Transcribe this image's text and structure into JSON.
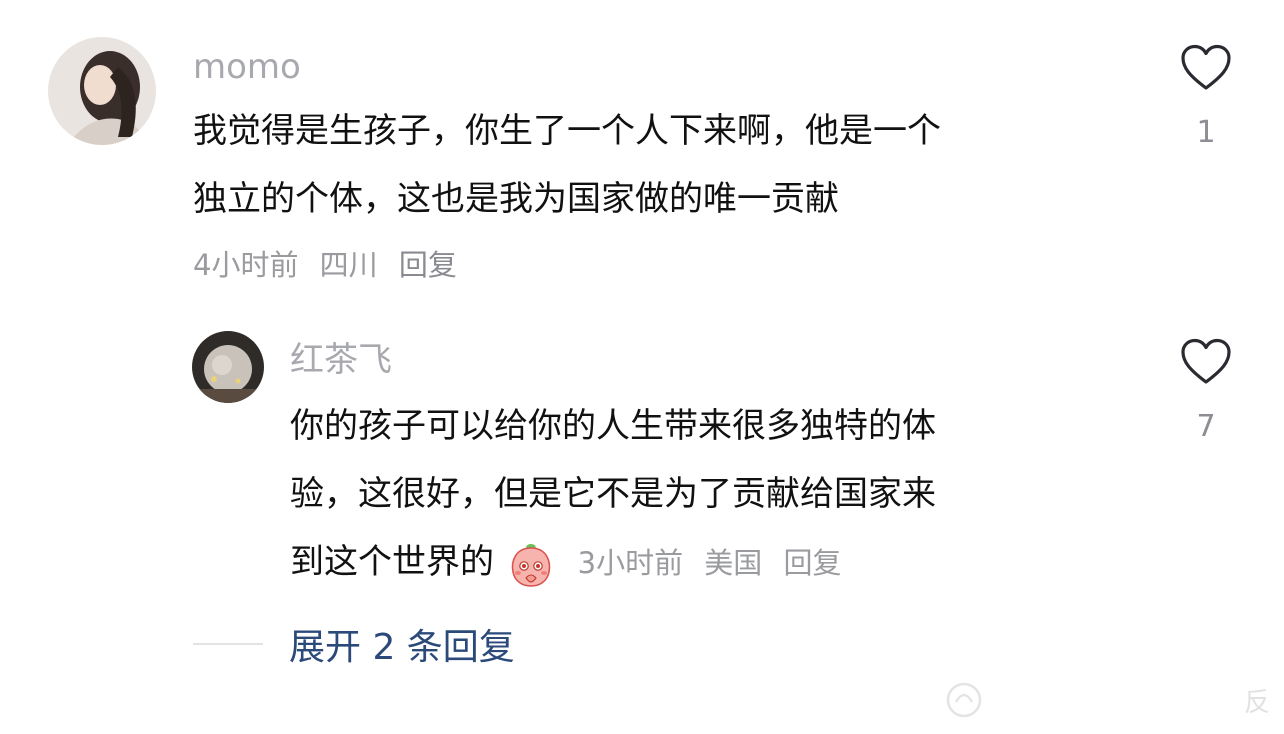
{
  "comments": [
    {
      "username": "momo",
      "text_lines": [
        "我觉得是生孩子，你生了一个人下来啊，他是一个",
        "独立的个体，这也是我为国家做的唯一贡献"
      ],
      "time": "4小时前",
      "location": "四川",
      "reply_label": "回复",
      "like_count": "1"
    }
  ],
  "reply": {
    "username": "红茶飞",
    "text_lines": [
      "你的孩子可以给你的人生带来很多独特的体",
      "验，这很好，但是它不是为了贡献给国家来",
      "到这个世界的"
    ],
    "emoji": "shy-peach-emoji",
    "time": "3小时前",
    "location": "美国",
    "reply_label": "回复",
    "like_count": "7"
  },
  "expand_label": "展开 2 条回复",
  "watermark_text": "反",
  "colors": {
    "username": "#a8a9ae",
    "meta": "#9a9b9f",
    "expand_link": "#2b4a7a",
    "text": "#111111"
  }
}
